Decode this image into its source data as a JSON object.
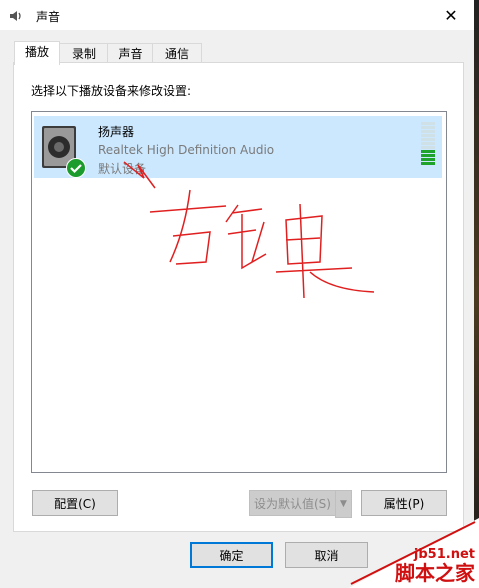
{
  "window": {
    "title": "声音",
    "close_glyph": "✕"
  },
  "tabs": [
    {
      "label": "播放",
      "active": true
    },
    {
      "label": "录制",
      "active": false
    },
    {
      "label": "声音",
      "active": false
    },
    {
      "label": "通信",
      "active": false
    }
  ],
  "playback": {
    "prompt": "选择以下播放设备来修改设置:",
    "device": {
      "name": "扬声器",
      "driver": "Realtek High Definition Audio",
      "status": "默认设备",
      "icon": "speaker-icon",
      "badge_icon": "check-icon",
      "level_segments_on": 4,
      "level_segments_total": 11
    }
  },
  "buttons": {
    "configure": "配置(C)",
    "set_default": "设为默认值(S)",
    "properties": "属性(P)",
    "ok": "确定",
    "cancel": "取消"
  },
  "annotation": {
    "handwriting": "右键"
  },
  "watermark": {
    "url": "jb51.net",
    "name": "脚本之家"
  },
  "colors": {
    "selection": "#cce8ff",
    "accent": "#0078d7",
    "meter_on": "#20a32b",
    "ink": "#d01010"
  }
}
